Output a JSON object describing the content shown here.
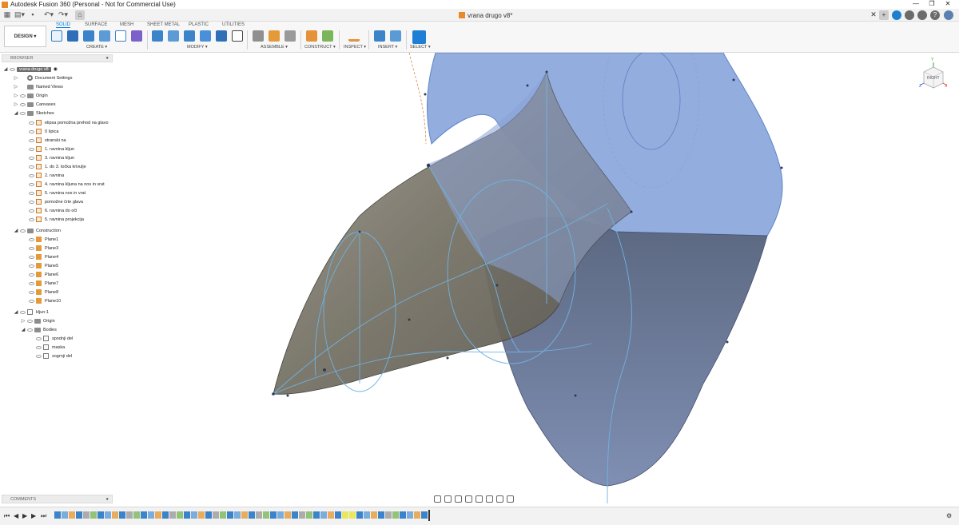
{
  "window": {
    "title": "Autodesk Fusion 360 (Personal - Not for Commercial Use)",
    "minimize": "—",
    "maximize": "❐",
    "close": "✕"
  },
  "document_tab": {
    "name": "vrana drugo v8*"
  },
  "toolbar": {
    "workspace": "DESIGN ▾",
    "tabs": [
      "SOLID",
      "SURFACE",
      "MESH",
      "SHEET METAL",
      "PLASTIC",
      "UTILITIES"
    ],
    "active_tab": "SOLID",
    "groups": {
      "create": "CREATE ▾",
      "modify": "MODIFY ▾",
      "assemble": "ASSEMBLE ▾",
      "construct": "CONSTRUCT ▾",
      "inspect": "INSPECT ▾",
      "insert": "INSERT ▾",
      "select": "SELECT ▾"
    }
  },
  "browser": {
    "header": "BROWSER",
    "root": "vrana drugo v8",
    "items": [
      {
        "label": "Document Settings",
        "kind": "gear"
      },
      {
        "label": "Named Views",
        "kind": "folder"
      },
      {
        "label": "Origin",
        "kind": "folder"
      },
      {
        "label": "Canvases",
        "kind": "folder"
      },
      {
        "label": "Sketches",
        "kind": "folder"
      }
    ],
    "sketches": [
      "elipsa pomožna prehod na glavo",
      "0 špica",
      "stranski na",
      "1. ravnina kljun",
      "3. ravnina kljun",
      "1. do 3. točka krivulje",
      "2. ravnina",
      "4. ravnina kljuna na nos in vrat",
      "5. ravnina nos in vrat",
      "pomožne črte glava",
      "6. ravnina do oči",
      "5. ravnina projekcija"
    ],
    "construction_label": "Construction",
    "planes": [
      "Plane1",
      "Plane3",
      "Plane4",
      "Plane5",
      "Plane6",
      "Plane7",
      "Plane8",
      "Plane10"
    ],
    "component": "kljun:1",
    "component_origin": "Origin",
    "bodies_label": "Bodies",
    "bodies": [
      "spodnji del",
      "maska",
      "zogrnji del"
    ]
  },
  "comments": {
    "header": "COMMENTS"
  },
  "viewcube": {
    "face": "RIGHT",
    "axis_x": "X",
    "axis_y": "Y",
    "axis_z": "Z"
  },
  "colors": {
    "accent": "#0a7bd6",
    "body_blue": "#8ea9df",
    "beak_gray": "#6e6b60",
    "curve": "#6fb3e3"
  }
}
